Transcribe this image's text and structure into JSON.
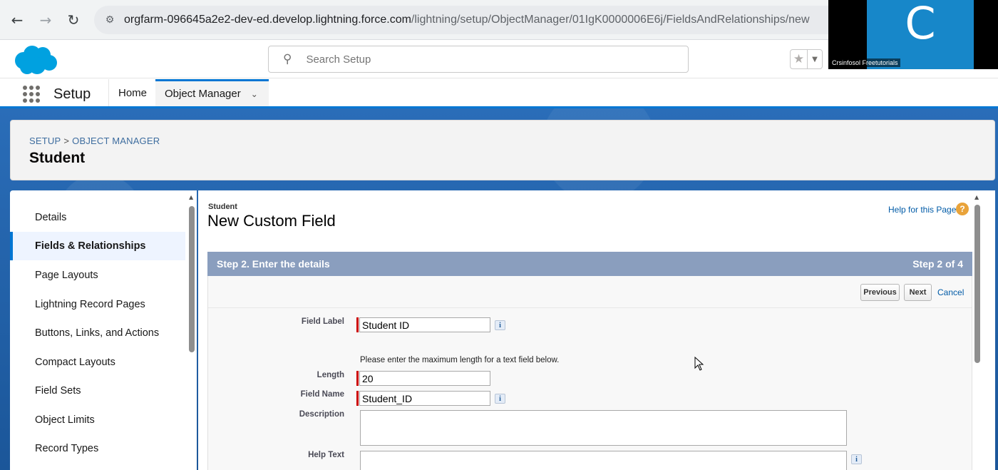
{
  "browser": {
    "url_host": "orgfarm-096645a2e2-dev-ed.develop.lightning.force.com",
    "url_path": "/lightning/setup/ObjectManager/01IgK0000006E6j/FieldsAndRelationships/new"
  },
  "webcam": {
    "initial": "C",
    "name": "Crsinfosol Freetutorials"
  },
  "header": {
    "search_placeholder": "Search Setup"
  },
  "context_nav": {
    "app_name": "Setup",
    "tabs": [
      {
        "label": "Home"
      },
      {
        "label": "Object Manager"
      }
    ]
  },
  "record_header": {
    "breadcrumb": [
      "SETUP",
      "OBJECT MANAGER"
    ],
    "breadcrumb_sep": ">",
    "title": "Student"
  },
  "sidebar": {
    "items": [
      {
        "label": "Details"
      },
      {
        "label": "Fields & Relationships"
      },
      {
        "label": "Page Layouts"
      },
      {
        "label": "Lightning Record Pages"
      },
      {
        "label": "Buttons, Links, and Actions"
      },
      {
        "label": "Compact Layouts"
      },
      {
        "label": "Field Sets"
      },
      {
        "label": "Object Limits"
      },
      {
        "label": "Record Types"
      }
    ],
    "active_index": 1
  },
  "main": {
    "object_label": "Student",
    "page_title": "New Custom Field",
    "help_link": "Help for this Page",
    "help_icon_glyph": "?",
    "step_title": "Step 2. Enter the details",
    "step_count": "Step 2 of 4",
    "buttons": {
      "previous": "Previous",
      "next": "Next",
      "cancel": "Cancel"
    },
    "form": {
      "field_label": {
        "label": "Field Label",
        "value": "Student ID"
      },
      "length_hint": "Please enter the maximum length for a text field below.",
      "length": {
        "label": "Length",
        "value": "20"
      },
      "field_name": {
        "label": "Field Name",
        "value": "Student_ID"
      },
      "description": {
        "label": "Description",
        "value": ""
      },
      "help_text": {
        "label": "Help Text",
        "value": ""
      }
    },
    "info_glyph": "i"
  },
  "colors": {
    "brand_blue": "#0176d3",
    "step_bar": "#8a9ebe",
    "required": "#cc0000",
    "link": "#015ba7"
  }
}
